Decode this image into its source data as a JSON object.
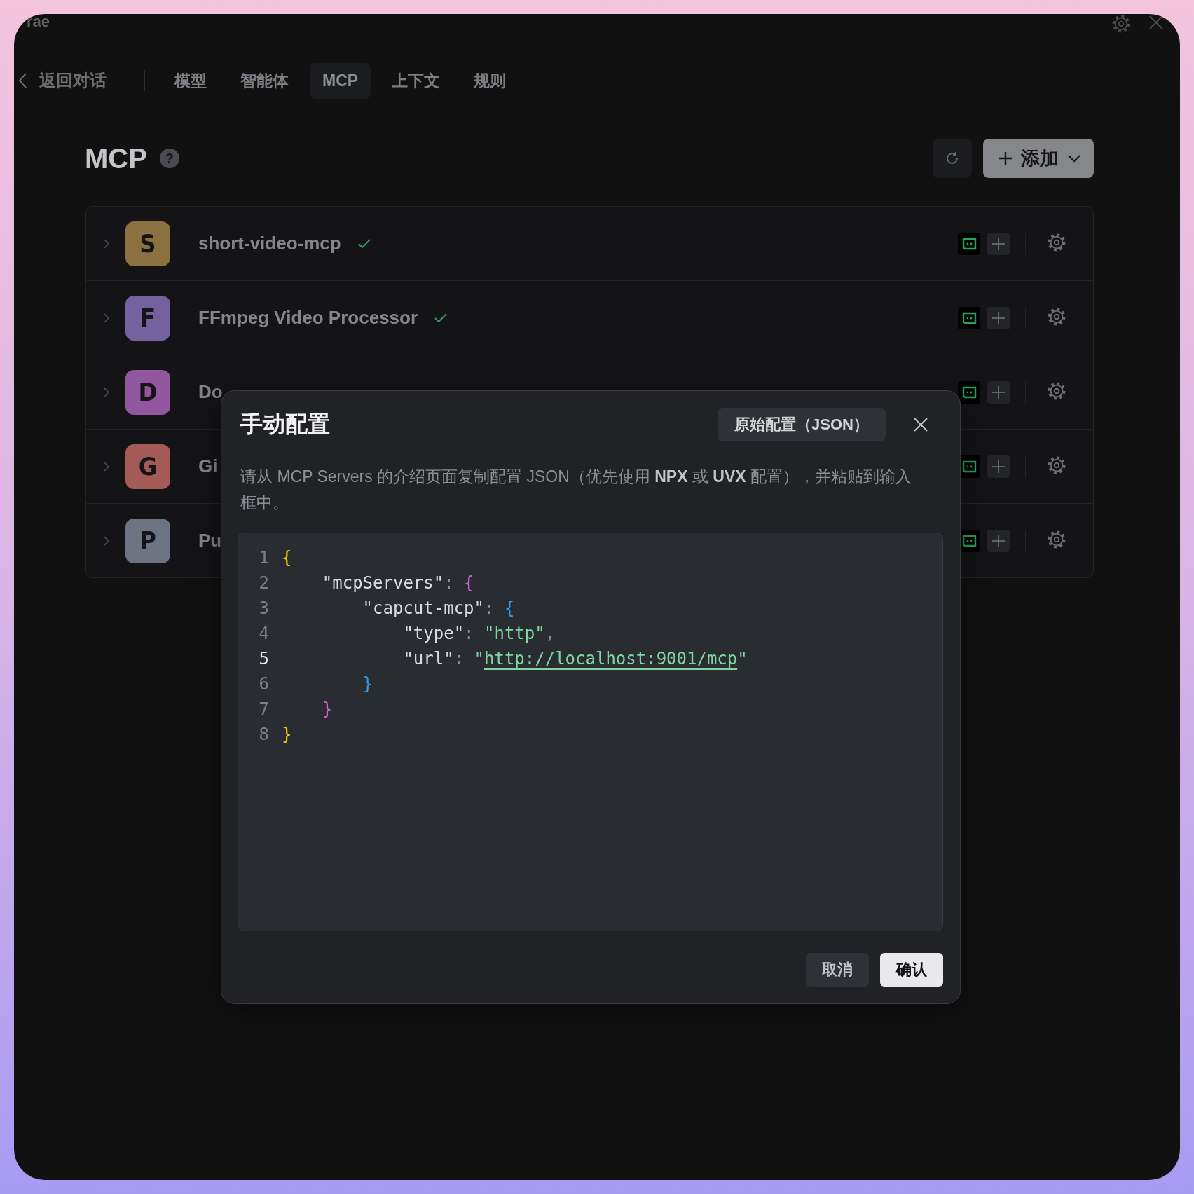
{
  "window": {
    "title": "rae"
  },
  "nav": {
    "back": "返回对话",
    "tabs": [
      {
        "label": "模型",
        "selected": false
      },
      {
        "label": "智能体",
        "selected": false
      },
      {
        "label": "MCP",
        "selected": true
      },
      {
        "label": "上下文",
        "selected": false
      },
      {
        "label": "规则",
        "selected": false
      }
    ]
  },
  "page": {
    "title": "MCP",
    "help": "?",
    "add_button": "添加"
  },
  "servers": [
    {
      "letter": "S",
      "name": "short-video-mcp",
      "color": "#8b7040",
      "verified": true
    },
    {
      "letter": "F",
      "name": "FFmpeg Video Processor",
      "color": "#7461a0",
      "verified": true
    },
    {
      "letter": "D",
      "name": "Do",
      "color": "#93579f"
    },
    {
      "letter": "G",
      "name": "Gi",
      "color": "#a45a56"
    },
    {
      "letter": "P",
      "name": "Pu",
      "color": "#6e7384"
    }
  ],
  "dialog": {
    "title": "手动配置",
    "raw_button": "原始配置（JSON）",
    "description": "请从 MCP Servers 的介绍页面复制配置 JSON（优先使用 **NPX** 或 **UVX** 配置），并粘贴到输入框中。",
    "lines": [
      {
        "number": "1",
        "current": false,
        "tokens": [
          {
            "kind": "brace1",
            "text": "{"
          }
        ]
      },
      {
        "number": "2",
        "current": false,
        "tokens": [
          {
            "kind": "key",
            "text": "    \"mcpServers\""
          },
          {
            "kind": "punct",
            "text": ": "
          },
          {
            "kind": "brace2",
            "text": "{"
          }
        ]
      },
      {
        "number": "3",
        "current": false,
        "tokens": [
          {
            "kind": "key",
            "text": "        \"capcut-mcp\""
          },
          {
            "kind": "punct",
            "text": ": "
          },
          {
            "kind": "brace3",
            "text": "{"
          }
        ]
      },
      {
        "number": "4",
        "current": false,
        "tokens": [
          {
            "kind": "key",
            "text": "            \"type\""
          },
          {
            "kind": "punct",
            "text": ": "
          },
          {
            "kind": "string",
            "text": "\"http\""
          },
          {
            "kind": "punct",
            "text": ","
          }
        ]
      },
      {
        "number": "5",
        "current": true,
        "tokens": [
          {
            "kind": "key",
            "text": "            \"url\""
          },
          {
            "kind": "punct",
            "text": ": "
          },
          {
            "kind": "string",
            "text": "\""
          },
          {
            "kind": "link",
            "text": "http://localhost:9001/mcp"
          },
          {
            "kind": "string",
            "text": "\""
          }
        ]
      },
      {
        "number": "6",
        "current": false,
        "tokens": [
          {
            "kind": "brace3",
            "text": "        }"
          }
        ]
      },
      {
        "number": "7",
        "current": false,
        "tokens": [
          {
            "kind": "brace2",
            "text": "    }"
          }
        ]
      },
      {
        "number": "8",
        "current": false,
        "tokens": [
          {
            "kind": "brace1",
            "text": "}"
          }
        ]
      }
    ],
    "buttons": [
      {
        "label": "取消",
        "kind": "secondary"
      },
      {
        "label": "确认",
        "kind": "primary"
      }
    ]
  }
}
